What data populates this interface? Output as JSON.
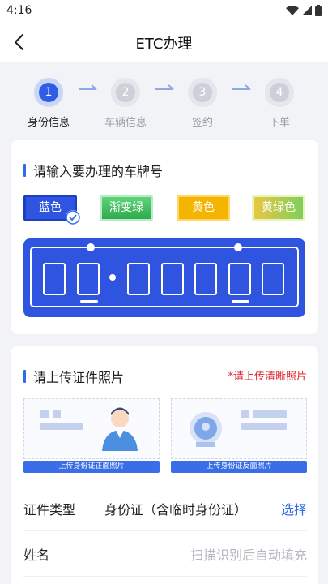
{
  "status_bar": {
    "time": "4:16",
    "icons": [
      "wifi-icon",
      "signal-icon",
      "battery-icon"
    ]
  },
  "nav": {
    "title": "ETC办理",
    "back_icon": "back-arrow-icon"
  },
  "steps": [
    {
      "number": "1",
      "label": "身份信息",
      "state": "active"
    },
    {
      "number": "2",
      "label": "车辆信息",
      "state": "todo"
    },
    {
      "number": "3",
      "label": "签约",
      "state": "todo"
    },
    {
      "number": "4",
      "label": "下单",
      "state": "todo"
    }
  ],
  "plate_section": {
    "title": "请输入要办理的车牌号",
    "colors": [
      {
        "label": "蓝色",
        "selected": true,
        "color": "#2f55e0"
      },
      {
        "label": "渐变绿",
        "selected": false,
        "color": "#3bbf5a"
      },
      {
        "label": "黄色",
        "selected": false,
        "color": "#f4b400"
      },
      {
        "label": "黄绿色",
        "selected": false,
        "color": "#a8cf4f"
      }
    ]
  },
  "upload_section": {
    "title": "请上传证件照片",
    "hint": "*请上传清晰照片",
    "front_caption": "上传身份证正面照片",
    "back_caption": "上传身份证反面照片"
  },
  "form": {
    "id_type_label": "证件类型",
    "id_type_value": "身份证（含临时身份证）",
    "id_type_action": "选择",
    "name_label": "姓名",
    "name_placeholder": "扫描识别后自动填充"
  },
  "colors": {
    "accent": "#2f6be8",
    "plate_blue": "#2f55e0",
    "hint_red": "#e2262c"
  }
}
